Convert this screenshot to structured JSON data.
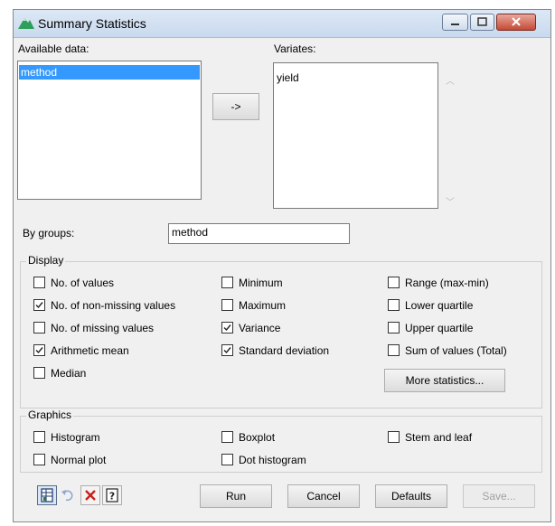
{
  "window": {
    "title": "Summary Statistics",
    "app_icon": "mountain-icon"
  },
  "titlebar_buttons": {
    "minimize": "minimize-icon",
    "maximize": "maximize-icon",
    "close": "close-icon"
  },
  "available_data": {
    "label": "Available data:",
    "items": [
      "method"
    ],
    "selected": "method"
  },
  "transfer_button": {
    "label": "->"
  },
  "variates": {
    "label": "Variates:",
    "items": [
      "yield"
    ]
  },
  "by_groups": {
    "label": "By groups:",
    "value": "method"
  },
  "display": {
    "title": "Display",
    "options": [
      {
        "label": "No. of values",
        "checked": false
      },
      {
        "label": "No. of non-missing values",
        "checked": true
      },
      {
        "label": "No. of missing values",
        "checked": false
      },
      {
        "label": "Arithmetic mean",
        "checked": true
      },
      {
        "label": "Median",
        "checked": false
      },
      {
        "label": "Minimum",
        "checked": false
      },
      {
        "label": "Maximum",
        "checked": false
      },
      {
        "label": "Variance",
        "checked": true
      },
      {
        "label": "Standard deviation",
        "checked": true
      },
      {
        "label": "Range (max-min)",
        "checked": false
      },
      {
        "label": "Lower quartile",
        "checked": false
      },
      {
        "label": "Upper quartile",
        "checked": false
      },
      {
        "label": "Sum of values (Total)",
        "checked": false
      }
    ],
    "more_button": "More statistics..."
  },
  "graphics": {
    "title": "Graphics",
    "options": [
      {
        "label": "Histogram",
        "checked": false
      },
      {
        "label": "Normal plot",
        "checked": false
      },
      {
        "label": "Boxplot",
        "checked": false
      },
      {
        "label": "Dot histogram",
        "checked": false
      },
      {
        "label": "Stem and leaf",
        "checked": false
      }
    ]
  },
  "toolbar_icons": [
    "spreadsheet-icon",
    "undo-icon",
    "clear-icon",
    "help-icon"
  ],
  "buttons": {
    "run": "Run",
    "cancel": "Cancel",
    "defaults": "Defaults",
    "save": "Save..."
  },
  "colors": {
    "selection": "#3399ff",
    "window_bg": "#f0f0f0",
    "close_button": "#c44a35"
  }
}
